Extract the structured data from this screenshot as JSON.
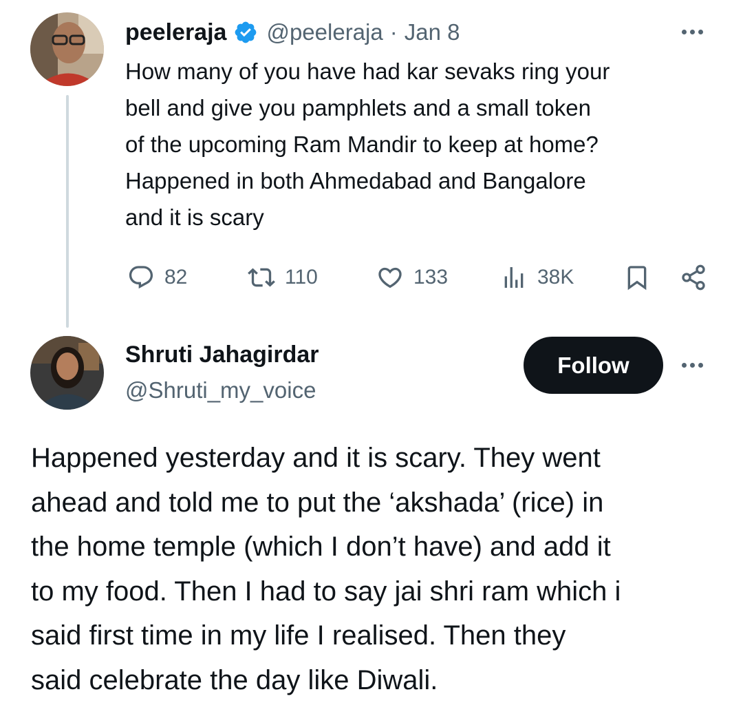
{
  "original_tweet": {
    "display_name": "peeleraja",
    "handle": "@peeleraja",
    "separator": "·",
    "date": "Jan 8",
    "text": "How many of you have had kar sevaks ring your bell and  give you pamphlets and a small token of the upcoming Ram Mandir to keep at home? Happened in both Ahmedabad and Bangalore and it is scary",
    "lines": [
      "How many of you have had kar sevaks ring your",
      "bell and  give you pamphlets and a small token",
      "of the upcoming Ram Mandir to keep at home?",
      "Happened in both Ahmedabad and Bangalore",
      "and it is scary"
    ],
    "actions": {
      "replies": "82",
      "reposts": "110",
      "likes": "133",
      "views": "38K"
    },
    "icons": {
      "verified": "verified-badge-icon",
      "more": "more-options-icon",
      "reply": "reply-icon",
      "repost": "repost-icon",
      "like": "like-icon",
      "views": "views-icon",
      "bookmark": "bookmark-icon",
      "share": "share-icon"
    }
  },
  "reply_tweet": {
    "display_name": "Shruti Jahagirdar",
    "handle": "@Shruti_my_voice",
    "follow_label": "Follow",
    "lines": [
      "Happened yesterday and it is scary. They went",
      "ahead and told me to put the ‘akshada’ (rice) in",
      "the home temple (which I don’t have) and add it",
      "to my food. Then I had to say jai shri ram which i",
      "said first time in my life I realised. Then they",
      "said celebrate the day like Diwali."
    ]
  },
  "colors": {
    "accent_verified": "#1d9bf0",
    "text_primary": "#0f1419",
    "text_secondary": "#536471",
    "thread_line": "#cfd9de",
    "follow_bg": "#0f1419"
  }
}
